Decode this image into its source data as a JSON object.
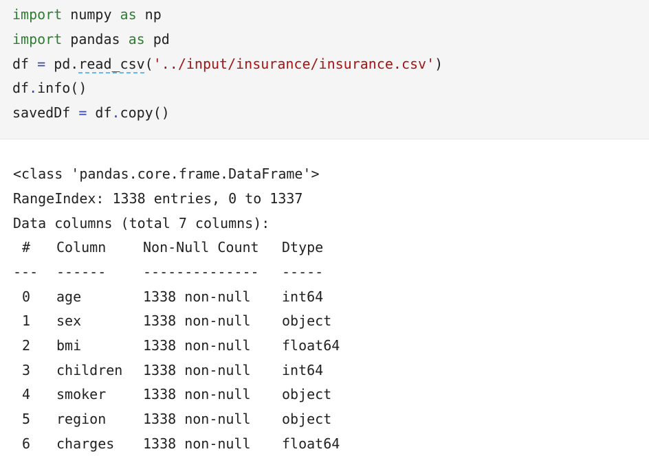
{
  "code": {
    "l1": {
      "kw1": "import",
      "t1": " numpy ",
      "kw2": "as",
      "t2": " np"
    },
    "l2": {
      "kw1": "import",
      "t1": " pandas ",
      "kw2": "as",
      "t2": " pd"
    },
    "l3": {
      "t1": "df ",
      "op": "=",
      "t2": " pd.",
      "fn": "read_csv",
      "t3": "(",
      "str": "'../input/insurance/insurance.csv'",
      "t4": ")"
    },
    "l4": {
      "t1": "df",
      "dot": ".",
      "t2": "info()"
    },
    "l5": {
      "t1": "savedDf ",
      "op": "=",
      "t2": " df",
      "dot": ".",
      "t3": "copy()"
    }
  },
  "output": {
    "class_line": "<class 'pandas.core.frame.DataFrame'>",
    "range_line": "RangeIndex: 1338 entries, 0 to 1337",
    "columns_line": "Data columns (total 7 columns):",
    "headers": {
      "idx": "#",
      "column": "Column",
      "count": "Non-Null Count",
      "dtype": "Dtype"
    },
    "separators": {
      "idx": "---",
      "column": "------",
      "count": "--------------",
      "dtype": "-----"
    },
    "rows": [
      {
        "idx": "0",
        "column": "age",
        "count": "1338 non-null",
        "dtype": "int64"
      },
      {
        "idx": "1",
        "column": "sex",
        "count": "1338 non-null",
        "dtype": "object"
      },
      {
        "idx": "2",
        "column": "bmi",
        "count": "1338 non-null",
        "dtype": "float64"
      },
      {
        "idx": "3",
        "column": "children",
        "count": "1338 non-null",
        "dtype": "int64"
      },
      {
        "idx": "4",
        "column": "smoker",
        "count": "1338 non-null",
        "dtype": "object"
      },
      {
        "idx": "5",
        "column": "region",
        "count": "1338 non-null",
        "dtype": "object"
      },
      {
        "idx": "6",
        "column": "charges",
        "count": "1338 non-null",
        "dtype": "float64"
      }
    ]
  }
}
